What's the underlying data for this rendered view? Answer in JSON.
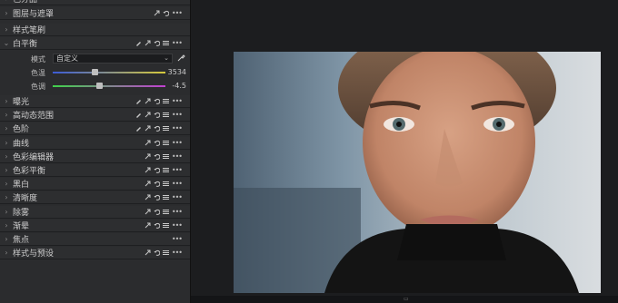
{
  "panel": {
    "rows_top": [
      {
        "label": "色分品",
        "chevron": "›",
        "tools": []
      },
      {
        "label": "图层与遮罩",
        "chevron": "›",
        "tools": [
          "link",
          "undo",
          "more"
        ]
      },
      {
        "label": "样式笔刷",
        "chevron": "›",
        "tools": []
      },
      {
        "label": "白平衡",
        "chevron": "⌄",
        "tools": [
          "pen",
          "link",
          "undo",
          "list",
          "more"
        ]
      }
    ],
    "white_balance": {
      "mode_label": "模式",
      "mode_value": "自定义",
      "temp_label": "色温",
      "temp_value": "3534",
      "temp_fraction": 0.37,
      "tint_label": "色调",
      "tint_value": "-4.5",
      "tint_fraction": 0.41
    },
    "rows_bottom": [
      {
        "label": "曝光",
        "tools": [
          "pen",
          "link",
          "undo",
          "list",
          "more"
        ]
      },
      {
        "label": "高动态范围",
        "tools": [
          "pen",
          "link",
          "undo",
          "list",
          "more"
        ]
      },
      {
        "label": "色阶",
        "tools": [
          "pen",
          "link",
          "undo",
          "list",
          "more"
        ]
      },
      {
        "label": "曲线",
        "tools": [
          "link",
          "undo",
          "list",
          "more"
        ]
      },
      {
        "label": "色彩编辑器",
        "tools": [
          "link",
          "undo",
          "list",
          "more"
        ]
      },
      {
        "label": "色彩平衡",
        "tools": [
          "link",
          "undo",
          "list",
          "more"
        ]
      },
      {
        "label": "黑白",
        "tools": [
          "link",
          "undo",
          "list",
          "more"
        ]
      },
      {
        "label": "清晰度",
        "tools": [
          "link",
          "undo",
          "list",
          "more"
        ]
      },
      {
        "label": "除雾",
        "tools": [
          "link",
          "undo",
          "list",
          "more"
        ]
      },
      {
        "label": "渐晕",
        "tools": [
          "link",
          "undo",
          "list",
          "more"
        ]
      },
      {
        "label": "焦点",
        "tools": [
          "more"
        ]
      },
      {
        "label": "样式与预设",
        "tools": [
          "link",
          "undo",
          "list",
          "more"
        ]
      }
    ]
  },
  "colors": {
    "temp_gradient": [
      "#3b5bd6",
      "#d6c93b"
    ],
    "tint_gradient": [
      "#3fd24a",
      "#c23fd2"
    ]
  }
}
